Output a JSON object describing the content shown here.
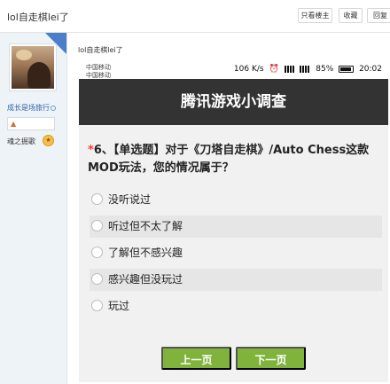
{
  "topbar": {
    "title": "lol自走棋lei了",
    "buttons": [
      "只看楼主",
      "收藏",
      "回复"
    ]
  },
  "sidebar": {
    "username": "成长是场旅行",
    "level": "魂之掘歌",
    "badge_icon": "flag-icon",
    "level_icon": "medal-icon"
  },
  "post": {
    "title": "lol自走棋lei了",
    "status": {
      "carrier1": "中国移动",
      "carrier2": "中国移动",
      "speed": "106 K/s",
      "battery": "85%",
      "time": "20:02"
    },
    "survey": {
      "header": "腾讯游戏小调查",
      "question_required_mark": "*",
      "question_text": "6、【单选题】对于《刀塔自走棋》/Auto Chess这款MOD玩法，您的情况属于？",
      "options": [
        "没听说过",
        "听过但不太了解",
        "了解但不感兴趣",
        "感兴趣但没玩过",
        "玩过"
      ],
      "prev_button": "上一页",
      "next_button": "下一页"
    }
  },
  "colors": {
    "header_bg": "#333333",
    "button_bg": "#7fb33c",
    "required": "#ff3b30"
  }
}
